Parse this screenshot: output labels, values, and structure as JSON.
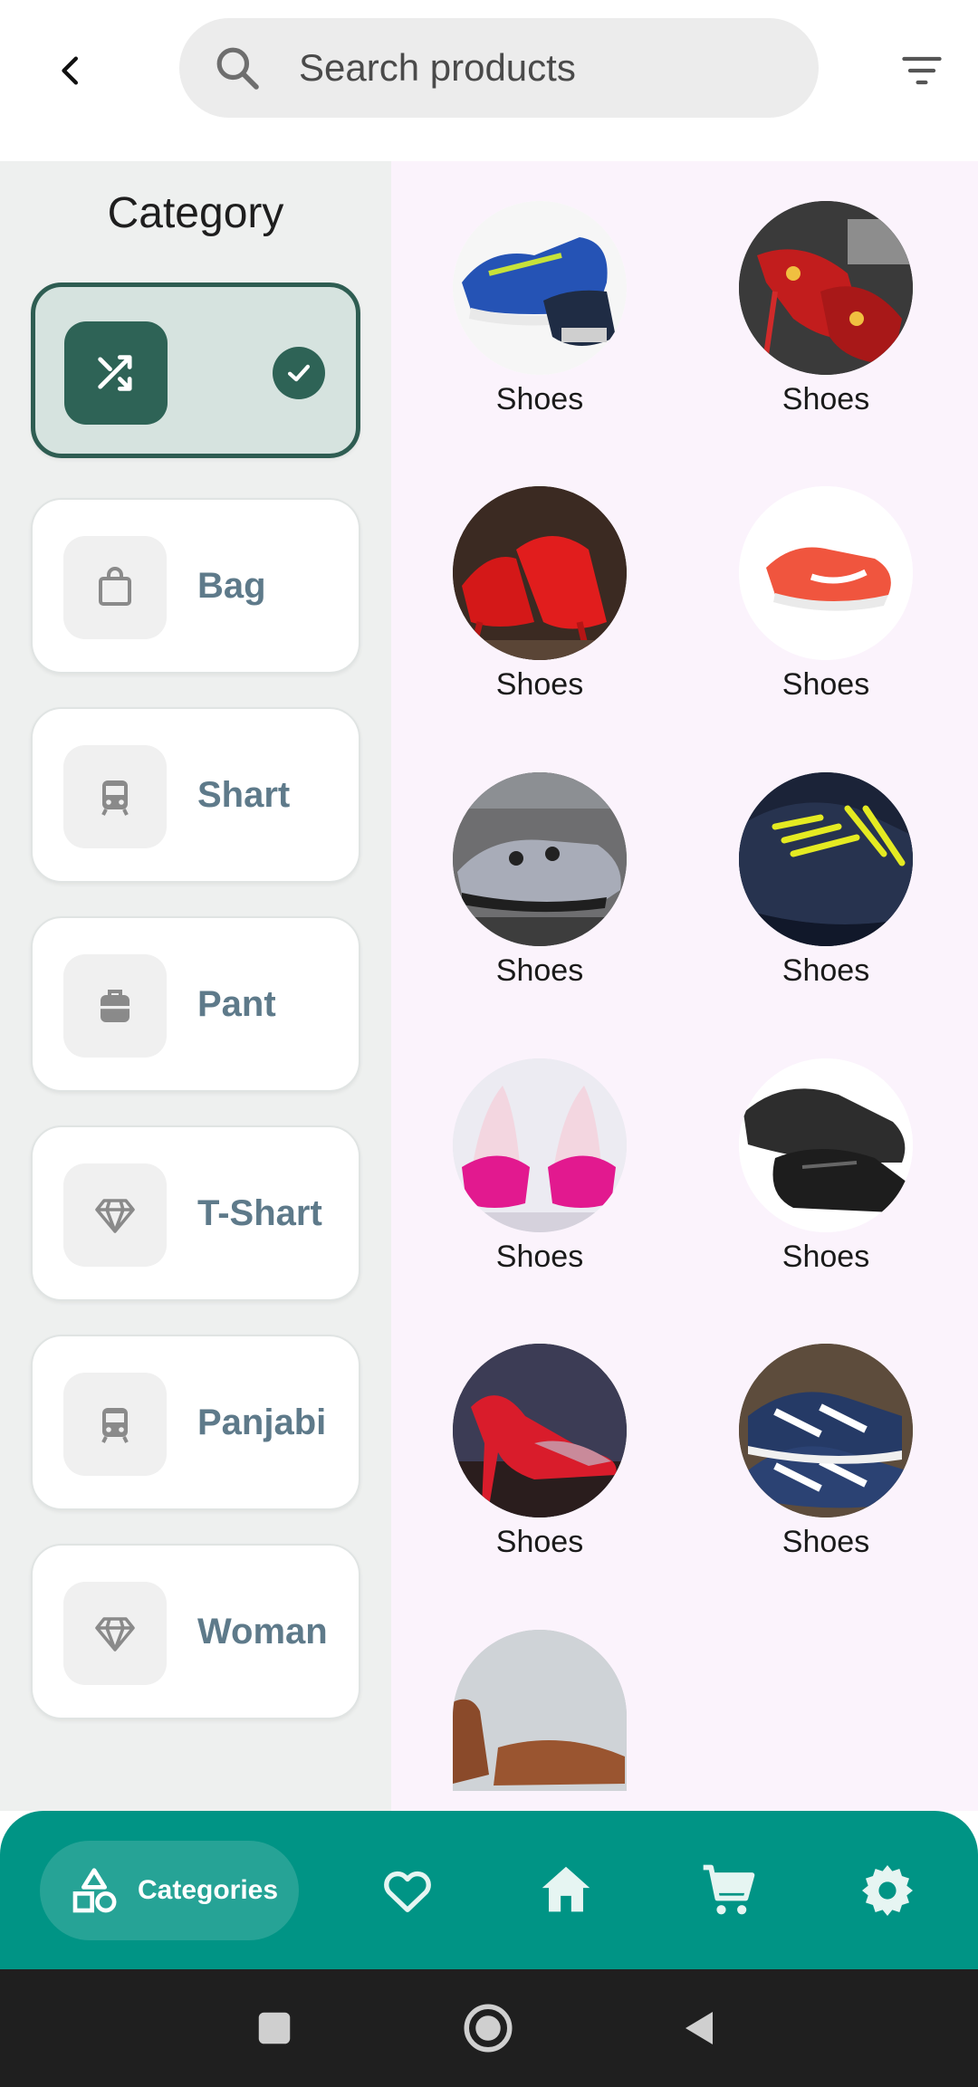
{
  "header": {
    "search_placeholder": "Search products"
  },
  "categories": {
    "title": "Category",
    "items": [
      {
        "label": "",
        "icon": "shuffle-icon",
        "selected": true
      },
      {
        "label": "Bag",
        "icon": "shopping-bag-icon",
        "selected": false
      },
      {
        "label": "Shart",
        "icon": "train-icon",
        "selected": false
      },
      {
        "label": "Pant",
        "icon": "luggage-icon",
        "selected": false
      },
      {
        "label": "T-Shart",
        "icon": "diamond-icon",
        "selected": false
      },
      {
        "label": "Panjabi",
        "icon": "train-icon",
        "selected": false
      },
      {
        "label": "Woman",
        "icon": "diamond-icon",
        "selected": false
      }
    ]
  },
  "products": [
    {
      "name": "Shoes"
    },
    {
      "name": "Shoes"
    },
    {
      "name": "Shoes"
    },
    {
      "name": "Shoes"
    },
    {
      "name": "Shoes"
    },
    {
      "name": "Shoes"
    },
    {
      "name": "Shoes"
    },
    {
      "name": "Shoes"
    },
    {
      "name": "Shoes"
    },
    {
      "name": "Shoes"
    },
    {
      "name": ""
    }
  ],
  "bottom_nav": {
    "active_label": "Categories",
    "items": [
      "categories-icon",
      "heart-icon",
      "home-icon",
      "cart-icon",
      "settings-icon"
    ]
  },
  "colors": {
    "accent": "#009485",
    "selected_category": "#2e6356",
    "grid_background": "#fbf3fc"
  }
}
